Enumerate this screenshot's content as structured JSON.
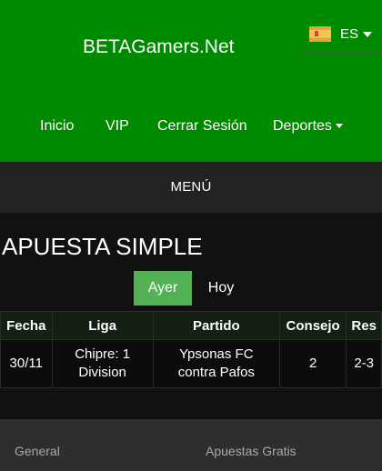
{
  "header": {
    "brand": "BETAGamers.Net",
    "language": {
      "label": "ES",
      "flag_icon": "spain-flag-icon"
    },
    "nav": {
      "inicio": "Inicio",
      "vip": "VIP",
      "cerrar_sesion": "Cerrar Sesión",
      "deportes": "Deportes"
    }
  },
  "menu": {
    "label": "MENÚ"
  },
  "main": {
    "title": "APUESTA SIMPLE",
    "day_tabs": {
      "active": "Ayer",
      "inactive": "Hoy"
    },
    "table": {
      "headers": {
        "fecha": "Fecha",
        "liga": "Liga",
        "partido": "Partido",
        "consejo": "Consejo",
        "res": "Res"
      },
      "rows": [
        {
          "fecha": "30/11",
          "liga_line1": "Chipre: 1",
          "liga_line2": "Division",
          "partido_line1": "Ypsonas FC",
          "partido_line2": "contra Pafos",
          "consejo": "2",
          "res": "2-3"
        }
      ]
    }
  },
  "footer": {
    "general": "General",
    "apuestas_gratis": "Apuestas Gratis"
  },
  "colors": {
    "header_green": "#008a00",
    "active_tab": "#52b152",
    "menu_bar": "#222222"
  }
}
